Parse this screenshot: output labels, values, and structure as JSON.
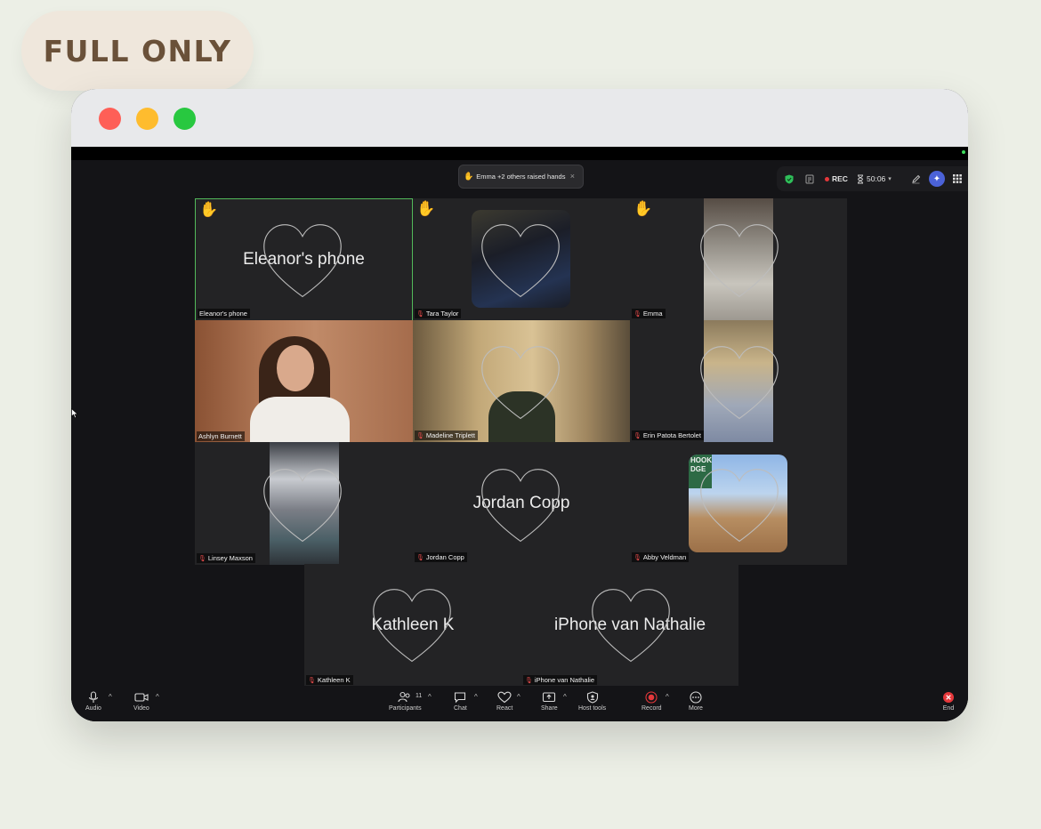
{
  "badge": {
    "label": "FULL ONLY"
  },
  "notice": {
    "hand_icon": "raised-hand-icon",
    "text": "Emma +2 others raised hands",
    "close": "×"
  },
  "status": {
    "rec": "REC",
    "timer": "50:06"
  },
  "tiles": [
    {
      "name": "Eleanor's phone",
      "big": "Eleanor's phone",
      "raised": true
    },
    {
      "name": "Tara Taylor",
      "raised": true
    },
    {
      "name": "Emma",
      "raised": true
    },
    {
      "name": "Ashlyn Burnett"
    },
    {
      "name": "Madeline Triplett"
    },
    {
      "name": "Erin Patota Bertolet"
    },
    {
      "name": "Linsey Maxson"
    },
    {
      "name": "Jordan Copp",
      "big": "Jordan Copp"
    },
    {
      "name": "Abby Veldman"
    },
    {
      "name": "Kathleen K",
      "big": "Kathleen K"
    },
    {
      "name": "iPhone van Nathalie",
      "big": "iPhone van Nathalie"
    }
  ],
  "toolbar": {
    "audio": "Audio",
    "video": "Video",
    "participants": "Participants",
    "participants_count": "11",
    "chat": "Chat",
    "react": "React",
    "share": "Share",
    "host_tools": "Host tools",
    "record": "Record",
    "more": "More",
    "end": "End"
  },
  "colors": {
    "page_bg": "#ecefe6",
    "badge_bg": "#efe7dc",
    "badge_text": "#6a5139",
    "active_border": "#52b95a",
    "record_red": "#e5383b"
  }
}
